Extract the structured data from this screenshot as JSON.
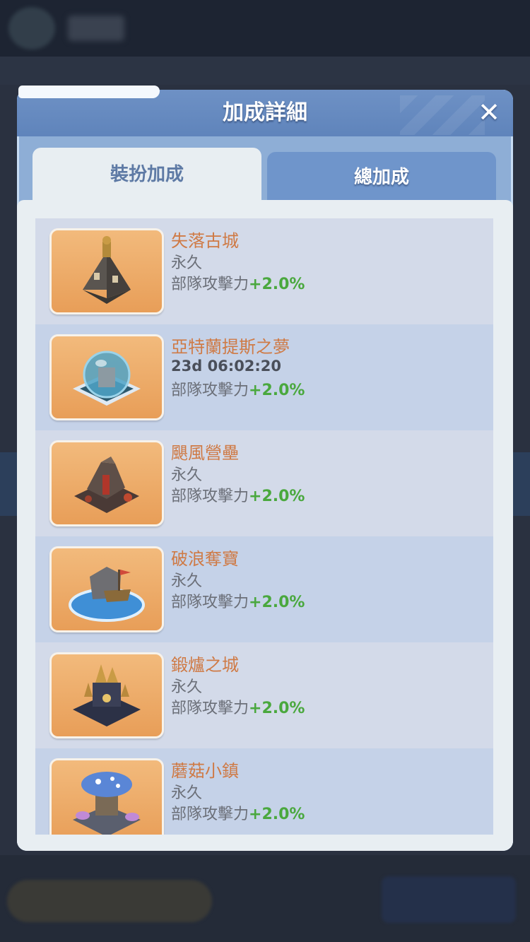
{
  "modal": {
    "title": "加成詳細",
    "close_icon": "close-icon"
  },
  "tabs": [
    {
      "label": "裝扮加成",
      "active": true
    },
    {
      "label": "總加成",
      "active": false
    }
  ],
  "items": [
    {
      "name": "失落古城",
      "duration": "永久",
      "stat_label": "部隊攻擊力",
      "stat_value": "+2.0%",
      "icon": "ancient-city-icon"
    },
    {
      "name": "亞特蘭提斯之夢",
      "duration": "23d 06:02:20",
      "stat_label": "部隊攻擊力",
      "stat_value": "+2.0%",
      "icon": "atlantis-globe-icon"
    },
    {
      "name": "颶風營壘",
      "duration": "永久",
      "stat_label": "部隊攻擊力",
      "stat_value": "+2.0%",
      "icon": "hurricane-fort-icon"
    },
    {
      "name": "破浪奪寶",
      "duration": "永久",
      "stat_label": "部隊攻擊力",
      "stat_value": "+2.0%",
      "icon": "pirate-ship-icon"
    },
    {
      "name": "鍛爐之城",
      "duration": "永久",
      "stat_label": "部隊攻擊力",
      "stat_value": "+2.0%",
      "icon": "forge-city-icon"
    },
    {
      "name": "蘑菇小鎮",
      "duration": "永久",
      "stat_label": "部隊攻擊力",
      "stat_value": "+2.0%",
      "icon": "mushroom-town-icon"
    }
  ],
  "colors": {
    "item_name": "#cf7a45",
    "stat_value": "#4aa83e",
    "header": "#6e91c5"
  }
}
